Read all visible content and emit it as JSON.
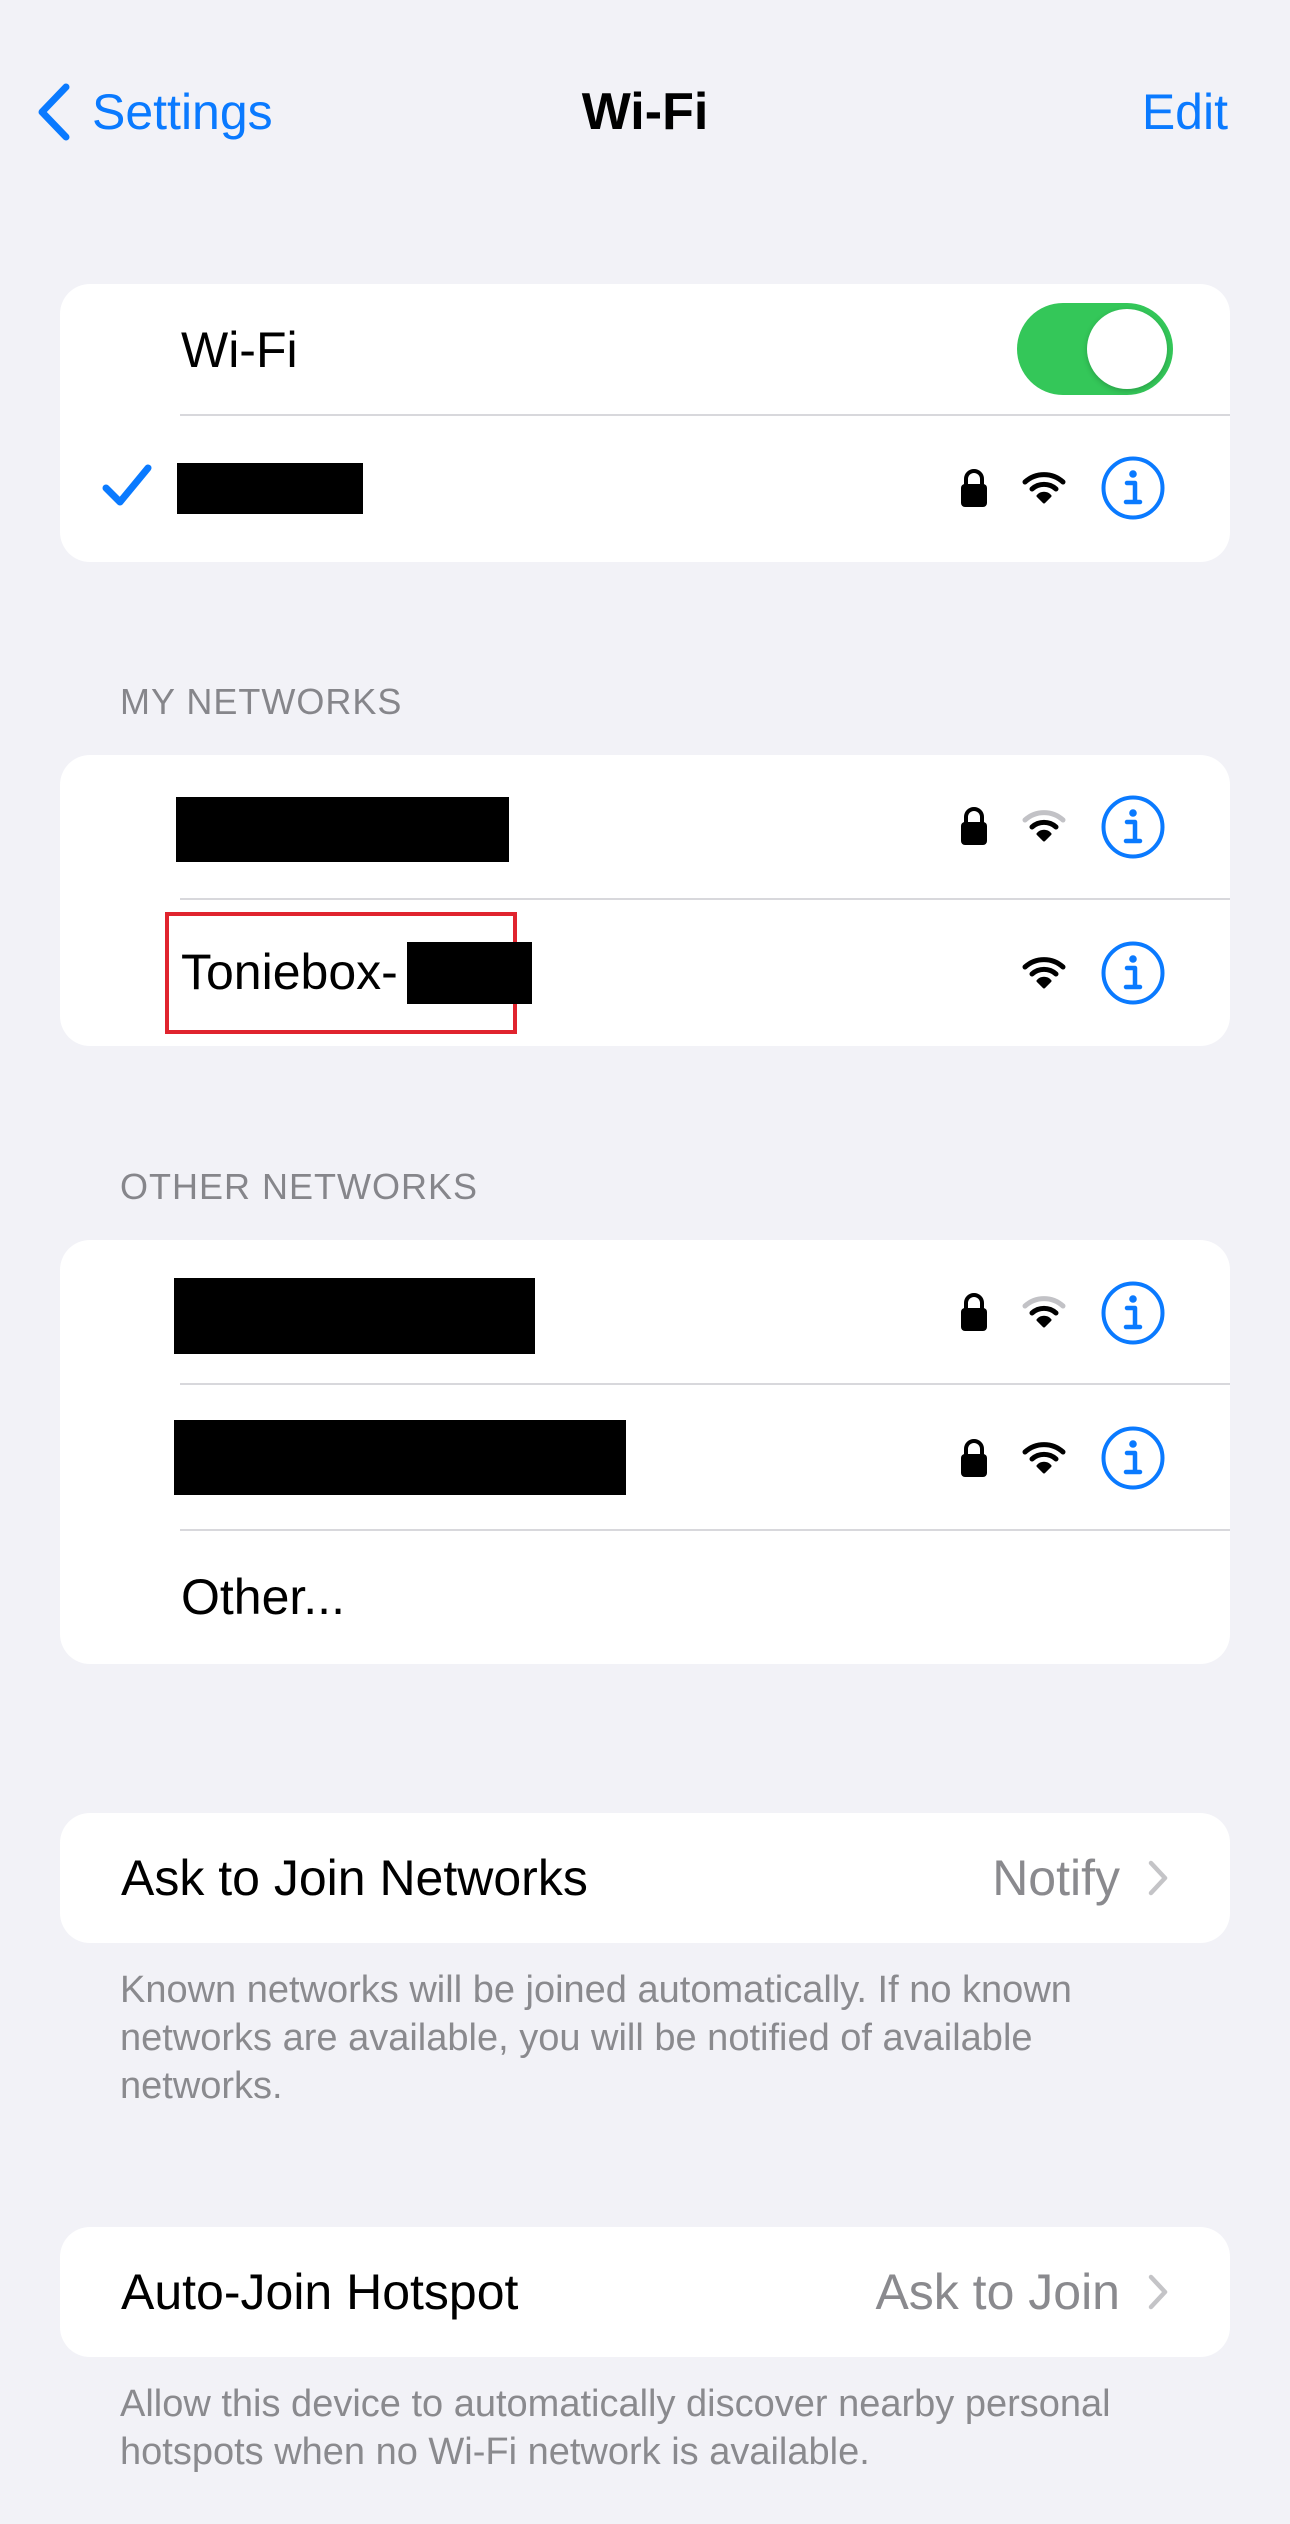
{
  "nav": {
    "back_label": "Settings",
    "title": "Wi-Fi",
    "edit_label": "Edit"
  },
  "wifi_card": {
    "toggle_label": "Wi-Fi",
    "toggle_on": true
  },
  "my_networks": {
    "header": "MY NETWORKS",
    "toniebox_prefix": "Toniebox-"
  },
  "other_networks": {
    "header": "OTHER NETWORKS",
    "other_label": "Other..."
  },
  "ask_to_join": {
    "label": "Ask to Join Networks",
    "value": "Notify",
    "footnote": "Known networks will be joined automatically. If no known networks are available, you will be notified of available networks."
  },
  "auto_join": {
    "label": "Auto-Join Hotspot",
    "value": "Ask to Join",
    "footnote": "Allow this device to automatically discover nearby personal hotspots when no Wi-Fi network is available."
  },
  "colors": {
    "accent": "#0a7aff",
    "toggle_on": "#34c759",
    "background": "#f2f2f7",
    "highlight": "#e0242e"
  },
  "icons": [
    "chevron-left-icon",
    "checkmark-icon",
    "lock-icon",
    "wifi-full-icon",
    "wifi-weak-icon",
    "info-icon",
    "chevron-right-icon"
  ]
}
